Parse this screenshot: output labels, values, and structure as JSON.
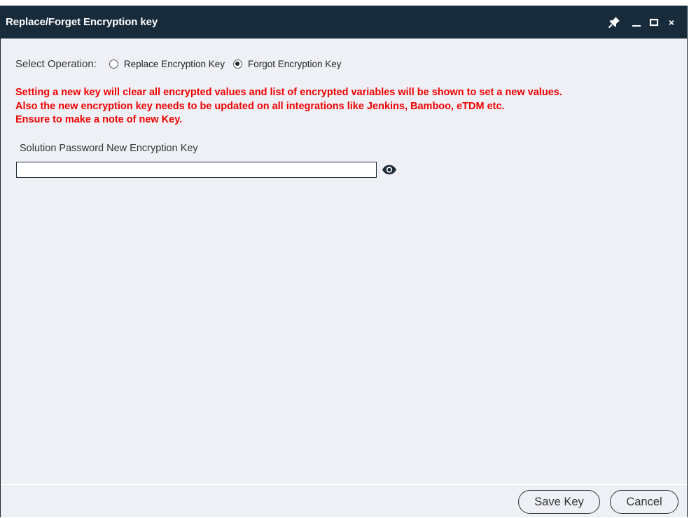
{
  "window": {
    "title": "Replace/Forget Encryption key",
    "controls": {
      "pin_icon": "pin-icon",
      "minimize_icon": "minimize-icon",
      "maximize_icon": "maximize-icon",
      "close_icon": "close-icon",
      "close_glyph": "×"
    }
  },
  "operation": {
    "label": "Select Operation:",
    "options": [
      {
        "label": "Replace Encryption Key",
        "selected": false
      },
      {
        "label": "Forgot Encryption Key",
        "selected": true
      }
    ]
  },
  "warning": {
    "color": "#ee0000",
    "lines": [
      "Setting a new key will clear all encrypted values and list of encrypted variables will be shown to set a new values.",
      "Also the new encryption key needs to be updated on all integrations like Jenkins, Bamboo, eTDM etc.",
      "Ensure to make a note of new Key."
    ]
  },
  "key_field": {
    "label": "Solution Password New Encryption Key",
    "value": "",
    "toggle_icon": "eye-icon"
  },
  "footer": {
    "save_label": "Save Key",
    "cancel_label": "Cancel"
  },
  "colors": {
    "titlebar": "#182b3a",
    "background": "#eef0f5"
  }
}
